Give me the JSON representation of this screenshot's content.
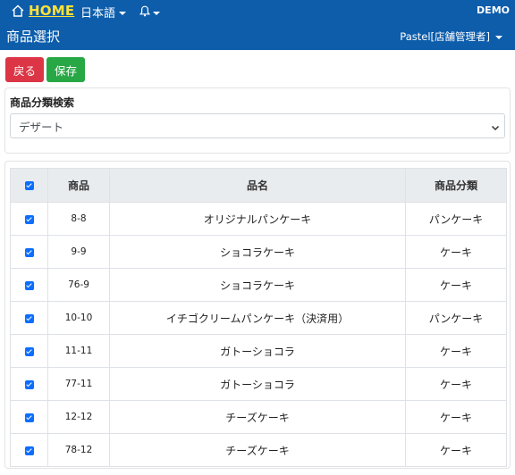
{
  "header": {
    "home_label": "HOME",
    "language_label": "日本語",
    "env_label": "DEMO",
    "page_title": "商品選択",
    "user_label": "Pastel[店舗管理者]"
  },
  "toolbar": {
    "back_label": "戻る",
    "save_label": "保存"
  },
  "filter": {
    "label": "商品分類検索",
    "selected": "デザート"
  },
  "table": {
    "columns": [
      "商品",
      "品名",
      "商品分類"
    ],
    "rows": [
      {
        "checked": true,
        "code": "8-8",
        "name": "オリジナルパンケーキ",
        "category": "パンケーキ"
      },
      {
        "checked": true,
        "code": "9-9",
        "name": "ショコラケーキ",
        "category": "ケーキ"
      },
      {
        "checked": true,
        "code": "76-9",
        "name": "ショコラケーキ",
        "category": "ケーキ"
      },
      {
        "checked": true,
        "code": "10-10",
        "name": "イチゴクリームパンケーキ（決済用）",
        "category": "パンケーキ"
      },
      {
        "checked": true,
        "code": "11-11",
        "name": "ガトーショコラ",
        "category": "ケーキ"
      },
      {
        "checked": true,
        "code": "77-11",
        "name": "ガトーショコラ",
        "category": "ケーキ"
      },
      {
        "checked": true,
        "code": "12-12",
        "name": "チーズケーキ",
        "category": "ケーキ"
      },
      {
        "checked": true,
        "code": "78-12",
        "name": "チーズケーキ",
        "category": "ケーキ"
      }
    ]
  },
  "colors": {
    "header_bg": "#0d5dab",
    "home_text": "#ffe135",
    "back_button": "#dc3545",
    "save_button": "#28a745",
    "checkbox": "#0d6efd"
  }
}
